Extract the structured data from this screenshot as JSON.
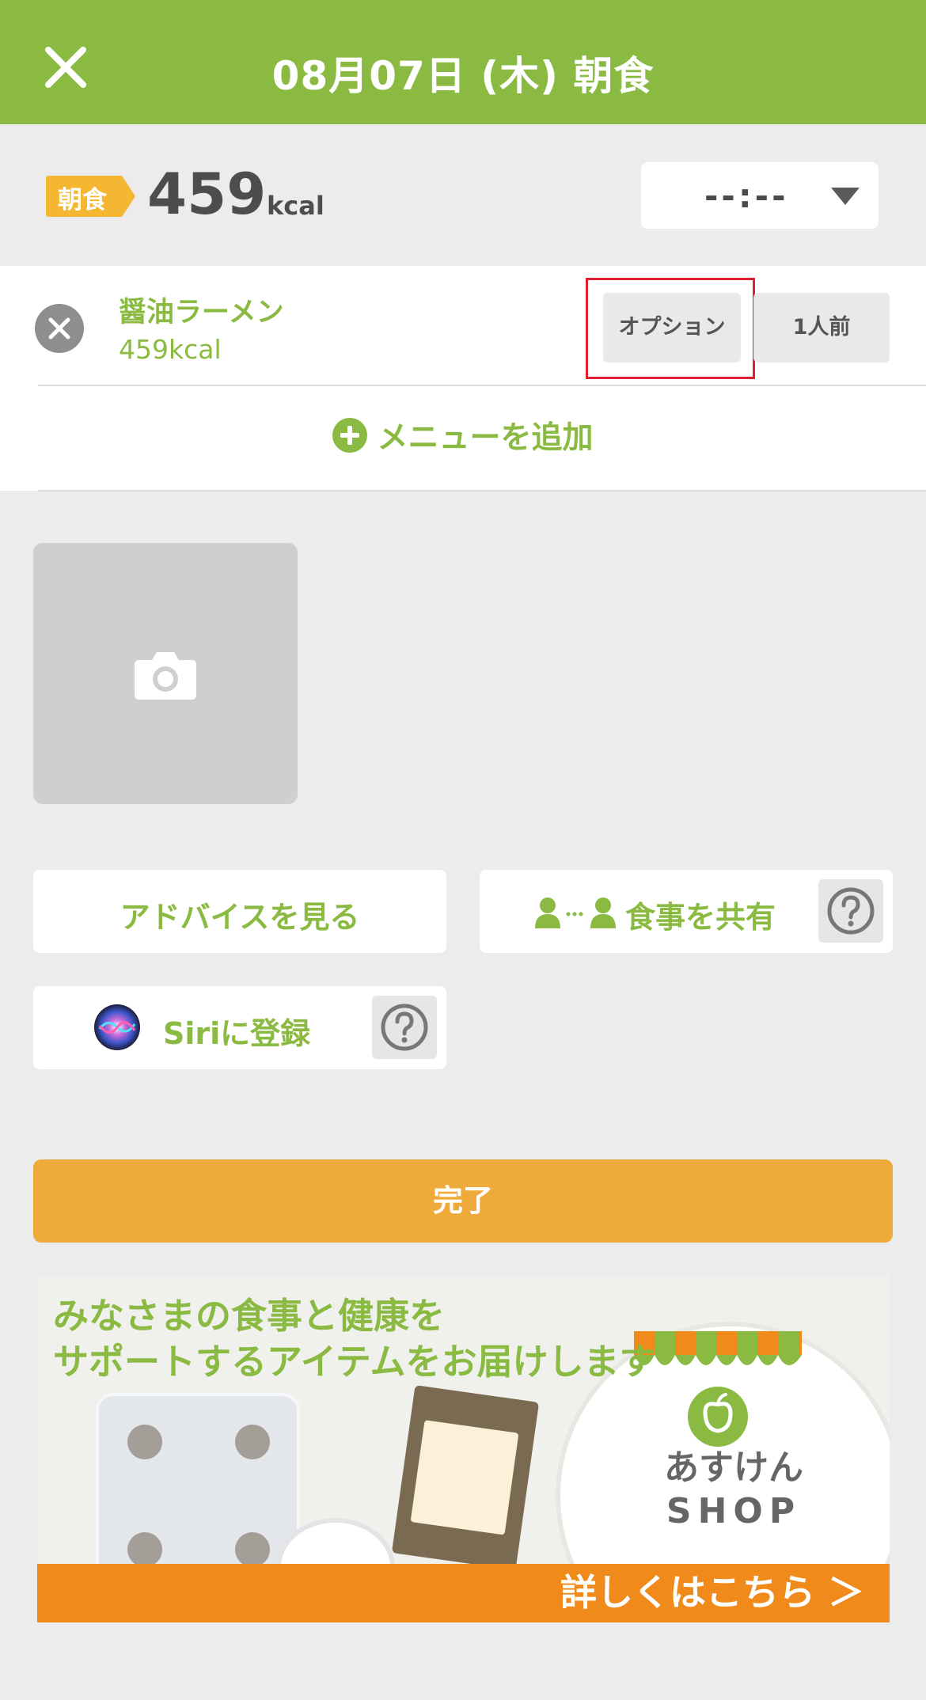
{
  "header": {
    "title": "08月07日 (木) 朝食",
    "close_icon": "close-icon",
    "background_color": "#8aba42"
  },
  "summary": {
    "meal_tag": "朝食",
    "meal_tag_color": "#f5b731",
    "kcal_value": "459",
    "kcal_unit": "kcal",
    "time_value": "--:--",
    "time_caret_icon": "caret-down-icon"
  },
  "menu": {
    "items": [
      {
        "name": "醤油ラーメン",
        "kcal": "459kcal",
        "option_label": "オプション",
        "portion_label": "1人前"
      }
    ],
    "add_label": "メニューを追加"
  },
  "photo": {
    "icon": "camera-icon"
  },
  "actions": {
    "advice_label": "アドバイスを見る",
    "share_label": "食事を共有",
    "siri_label": "Siriに登録",
    "help_icon": "help-icon"
  },
  "done": {
    "label": "完了",
    "color": "#eeaa3b"
  },
  "banner": {
    "line1": "みなさまの食事と健康を",
    "line2": "サポートするアイテムをお届けします",
    "shop_line1": "あすけん",
    "shop_line2": "SHOP",
    "cta": "詳しくはこちら ＞"
  }
}
